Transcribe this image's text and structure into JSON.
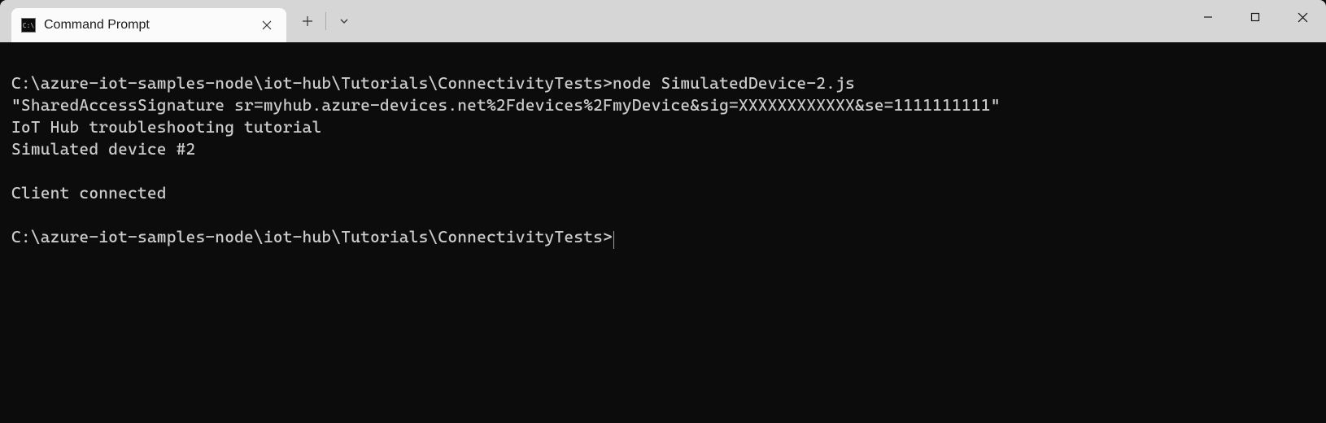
{
  "window": {
    "tab_title": "Command Prompt"
  },
  "terminal": {
    "lines": [
      "",
      "C:\\azure-iot-samples-node\\iot-hub\\Tutorials\\ConnectivityTests>node SimulatedDevice-2.js",
      "\"SharedAccessSignature sr=myhub.azure-devices.net%2Fdevices%2FmyDevice&sig=XXXXXXXXXXXX&se=1111111111\"",
      "IoT Hub troubleshooting tutorial",
      "Simulated device #2",
      "",
      "Client connected",
      ""
    ],
    "prompt": "C:\\azure-iot-samples-node\\iot-hub\\Tutorials\\ConnectivityTests>"
  }
}
